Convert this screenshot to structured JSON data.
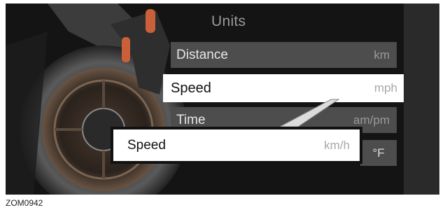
{
  "menu": {
    "title": "Units",
    "rows": [
      {
        "label": "Distance",
        "value": "km"
      },
      {
        "label": "Speed",
        "value": "mph"
      },
      {
        "label": "Time",
        "value": "am/pm"
      },
      {
        "label": "",
        "value": "°F"
      }
    ]
  },
  "callout": {
    "label": "Speed",
    "value": "km/h"
  },
  "figure_code": "ZOM0942",
  "colors": {
    "background": "#141414",
    "row": "#4d4d4d",
    "selected": "#ffffff",
    "accent": "#c9603a"
  }
}
